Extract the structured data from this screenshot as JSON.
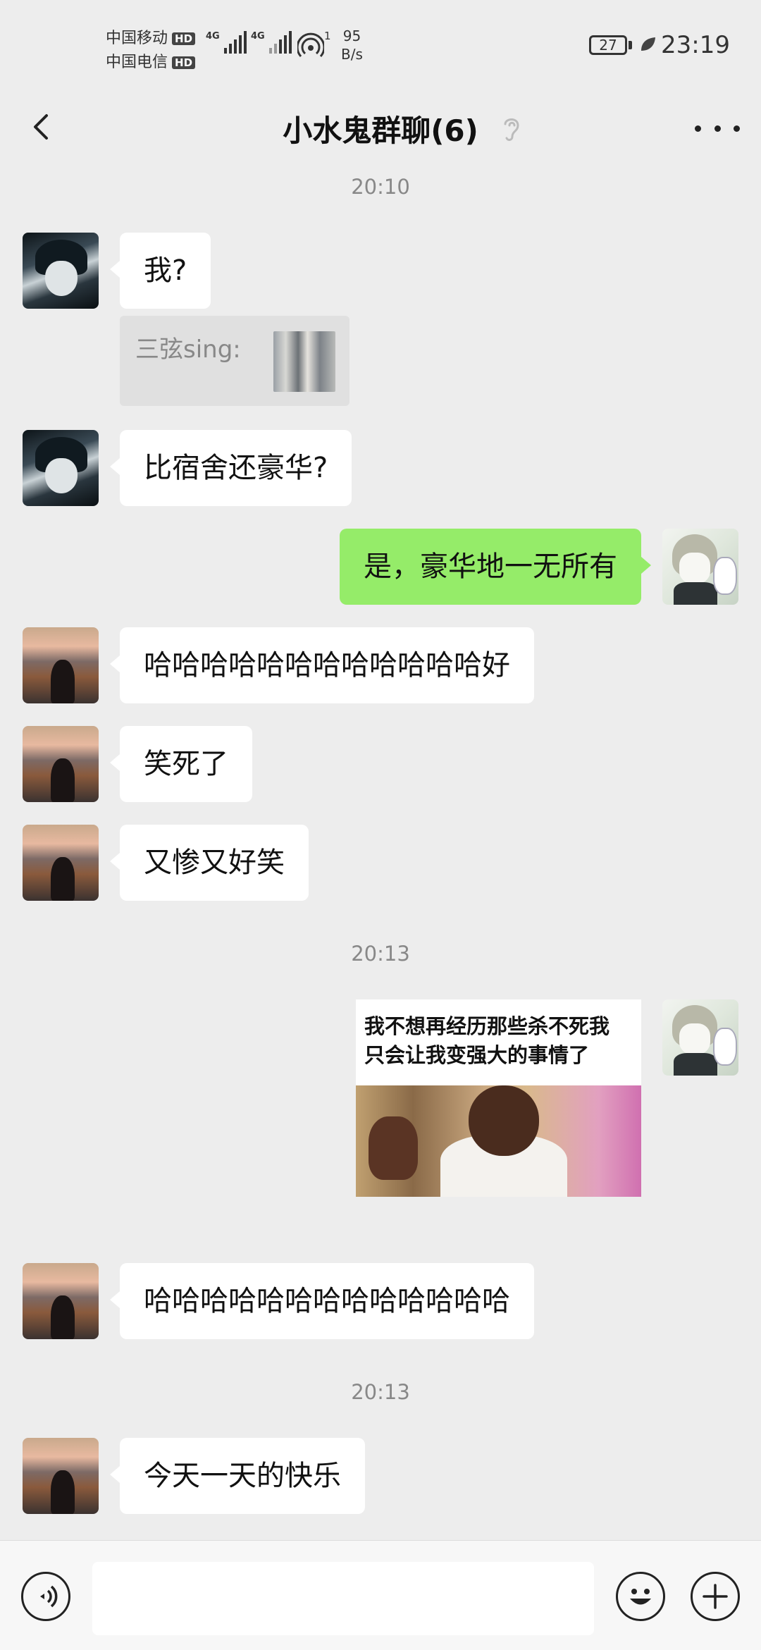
{
  "status_bar": {
    "carrier1": "中国移动",
    "carrier2": "中国电信",
    "hd_badge": "HD",
    "net1": "4G",
    "net2": "4G",
    "wifi_count": "1",
    "speed_value": "95",
    "speed_unit": "B/s",
    "battery": "27",
    "time": "23:19"
  },
  "header": {
    "title": "小水鬼群聊(6)",
    "back_icon": "chevron-left-icon",
    "mute_icon": "ear-icon",
    "more_icon": "more-dots-icon"
  },
  "messages": [
    {
      "kind": "timestamp",
      "text": "20:10"
    },
    {
      "kind": "text",
      "side": "left",
      "avatar": "anime-dark-hair",
      "text": "我?"
    },
    {
      "kind": "quote",
      "side": "left",
      "text": "三弦sing:",
      "thumb": "dorm-photo"
    },
    {
      "kind": "text",
      "side": "left",
      "avatar": "anime-dark-hair",
      "text": "比宿舍还豪华?"
    },
    {
      "kind": "text",
      "side": "right",
      "avatar": "anime-white-hair",
      "text": "是，豪华地一无所有"
    },
    {
      "kind": "text",
      "side": "left",
      "avatar": "city-sunset",
      "text": "哈哈哈哈哈哈哈哈哈哈哈哈好"
    },
    {
      "kind": "text",
      "side": "left",
      "avatar": "city-sunset",
      "text": "笑死了"
    },
    {
      "kind": "text",
      "side": "left",
      "avatar": "city-sunset",
      "text": "又惨又好笑"
    },
    {
      "kind": "timestamp",
      "text": "20:13"
    },
    {
      "kind": "image",
      "side": "right",
      "avatar": "anime-white-hair",
      "caption": "我不想再经历那些杀不死我\n只会让我变强大的事情了"
    },
    {
      "kind": "text",
      "side": "left",
      "avatar": "city-sunset",
      "text": "哈哈哈哈哈哈哈哈哈哈哈哈哈"
    },
    {
      "kind": "timestamp",
      "text": "20:13"
    },
    {
      "kind": "text",
      "side": "left",
      "avatar": "city-sunset",
      "text": "今天一天的快乐"
    }
  ],
  "input_bar": {
    "voice_icon": "voice-icon",
    "input_value": "",
    "emoji_icon": "emoji-icon",
    "plus_icon": "plus-icon"
  },
  "colors": {
    "background": "#ededed",
    "bubble_self": "#95ec69",
    "bubble_other": "#ffffff",
    "timestamp": "#888888"
  }
}
